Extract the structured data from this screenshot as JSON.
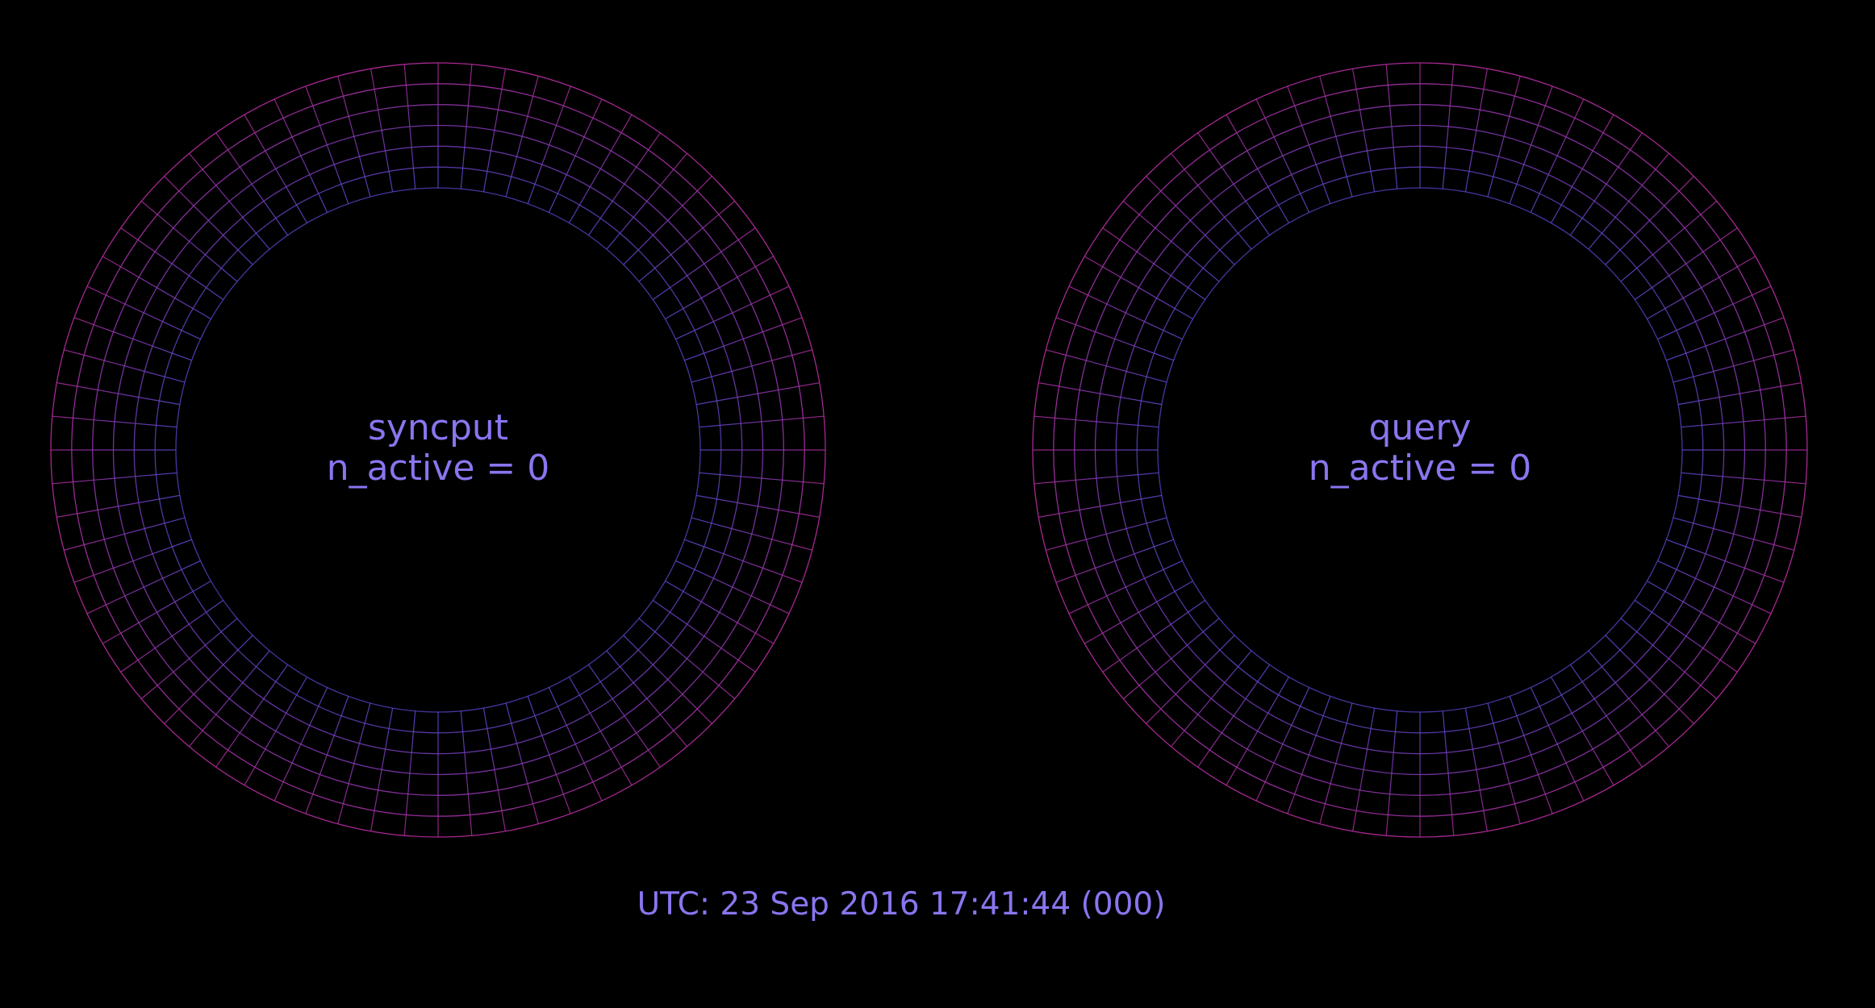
{
  "theme": {
    "background": "#000000",
    "text_color": "#8a75ef",
    "grid_inner_color": "#5a4bd6",
    "grid_outer_color": "#b02a9a"
  },
  "rings": [
    {
      "name": "syncput",
      "active_label": "n_active = 0",
      "n_active": 0
    },
    {
      "name": "query",
      "active_label": "n_active = 0",
      "n_active": 0
    }
  ],
  "footer": {
    "utc_text": "UTC: 23 Sep 2016 17:41:44 (000)"
  }
}
